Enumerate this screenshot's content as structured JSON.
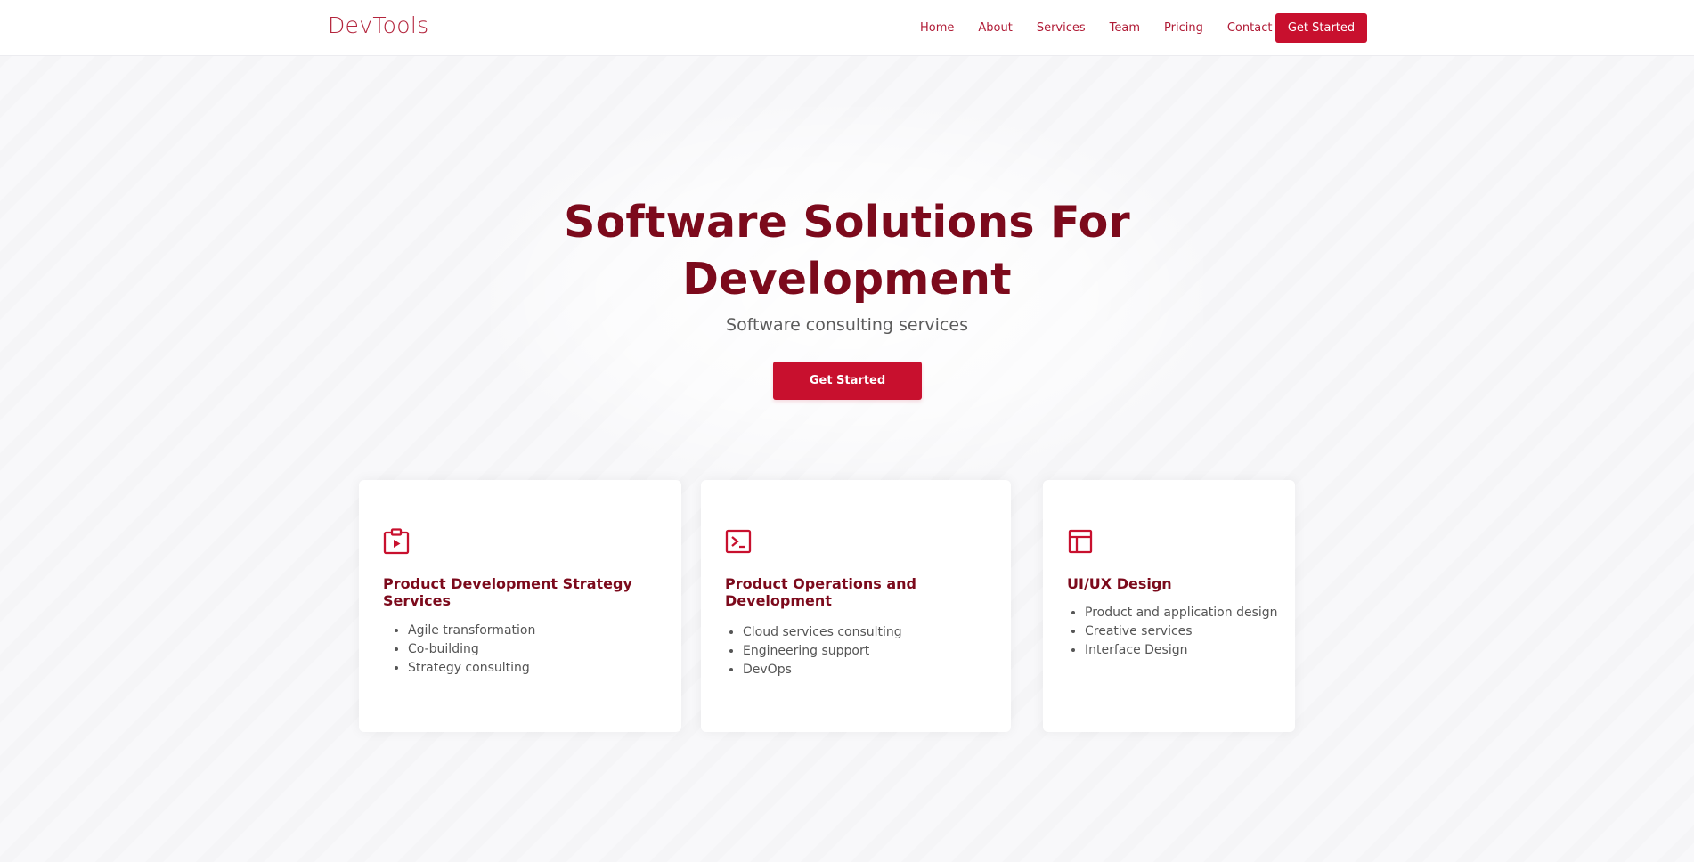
{
  "header": {
    "logo": "DevTools",
    "nav": [
      {
        "label": "Home"
      },
      {
        "label": "About"
      },
      {
        "label": "Services"
      },
      {
        "label": "Team"
      },
      {
        "label": "Pricing"
      },
      {
        "label": "Contact"
      }
    ],
    "cta_label": "Get Started"
  },
  "hero": {
    "title": "Software Solutions For Development",
    "subtitle": "Software consulting services",
    "cta_label": "Get Started"
  },
  "services": [
    {
      "icon": "clipboard-play-icon",
      "title": "Product Development Strategy Services",
      "items": [
        "Agile transformation",
        "Co-building",
        "Strategy consulting"
      ]
    },
    {
      "icon": "terminal-icon",
      "title": "Product Operations and Development",
      "items": [
        "Cloud services consulting",
        "Engineering support",
        "DevOps"
      ]
    },
    {
      "icon": "layout-icon",
      "title": "UI/UX Design",
      "items": [
        "Product and application design",
        "Creative services",
        "Interface Design"
      ]
    }
  ],
  "colors": {
    "accent": "#c8102e",
    "title": "#7c0a1c",
    "nav_text": "#b01b36",
    "background": "#f8f8fa"
  }
}
